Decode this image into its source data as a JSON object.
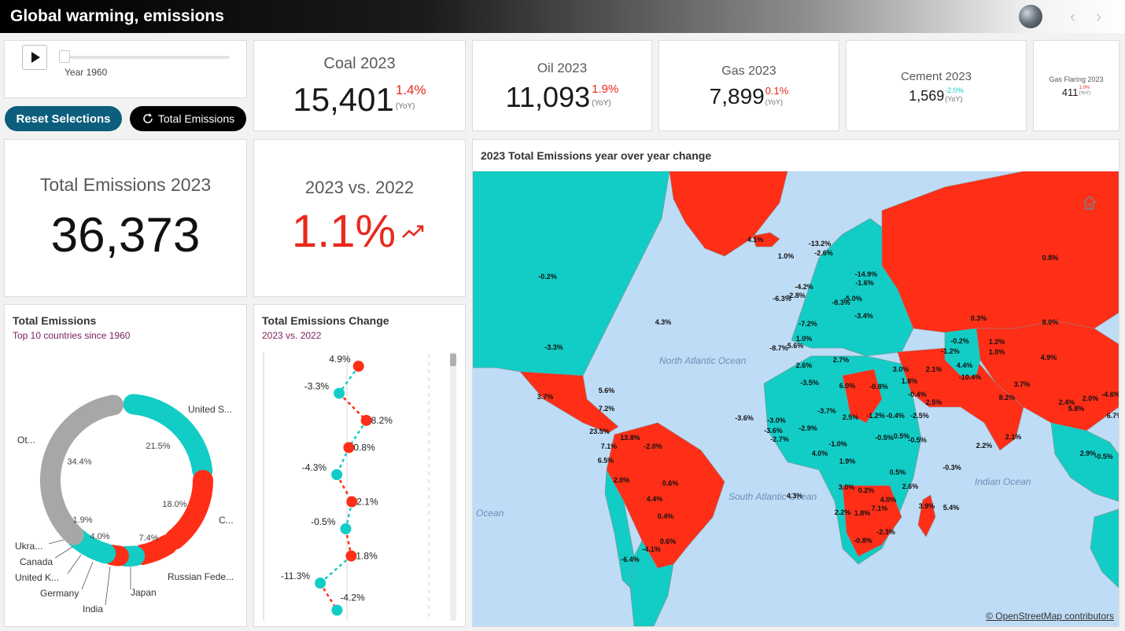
{
  "header": {
    "title": "Global warming, emissions",
    "prev_icon": "chevron-left-icon",
    "next_icon": "chevron-right-icon"
  },
  "player": {
    "play_icon": "play-icon",
    "year_label": "Year 1960",
    "slider_value": 1960
  },
  "buttons": {
    "reset": "Reset Selections",
    "total": "Total Emissions",
    "total_icon": "refresh-icon"
  },
  "kpis": [
    {
      "title": "Coal 2023",
      "value": "15,401",
      "pct": "1.4%",
      "yoy": "(YoY)"
    },
    {
      "title": "Oil 2023",
      "value": "11,093",
      "pct": "1.9%",
      "yoy": "(YoY)"
    },
    {
      "title": "Gas 2023",
      "value": "7,899",
      "pct": "0.1%",
      "yoy": "(YoY)"
    },
    {
      "title": "Cement 2023",
      "value": "1,569",
      "pct": "-2.0%",
      "yoy": "(YoY)"
    },
    {
      "title": "Gas Flaring 2023",
      "value": "411",
      "pct": "1.0%",
      "yoy": "(YoY)"
    }
  ],
  "total": {
    "title": "Total Emissions 2023",
    "value": "36,373"
  },
  "compare": {
    "title": "2023 vs. 2022",
    "value": "1.1%",
    "trend_icon": "trend-up-icon"
  },
  "colors": {
    "increase": "#ff2e17",
    "decrease": "#12cdc6",
    "other": "#a7a7a7",
    "water": "#bedcf5",
    "reset_button": "#0c5e7c"
  },
  "donut": {
    "title": "Total Emissions",
    "subtitle": "Top 10 countries since 1960",
    "chart_data": {
      "type": "pie",
      "categories": [
        "United S...",
        "C...",
        "Russian Fede...",
        "Japan",
        "India",
        "Germany",
        "United K...",
        "Canada",
        "Ukra...",
        "Ot..."
      ],
      "values": [
        21.5,
        18.0,
        7.4,
        4.0,
        1.9,
        0,
        0,
        0,
        0,
        34.4
      ],
      "value_labels": [
        "21.5%",
        "18.0%",
        "7.4%",
        "4.0%",
        "1.9%",
        "",
        "",
        "",
        "",
        "34.4%"
      ]
    }
  },
  "change": {
    "title": "Total Emissions Change",
    "subtitle": "2023 vs. 2022",
    "chart_data": {
      "type": "line",
      "values": [
        4.9,
        -3.3,
        8.2,
        0.8,
        -4.3,
        2.1,
        -0.5,
        1.8,
        -11.3,
        -4.2
      ],
      "labels": [
        "4.9%",
        "-3.3%",
        "8.2%",
        "0.8%",
        "-4.3%",
        "2.1%",
        "-0.5%",
        "1.8%",
        "-11.3%",
        "-4.2%"
      ]
    }
  },
  "map": {
    "title": "2023 Total Emissions year over year change",
    "credit": "© OpenStreetMap contributors",
    "home_icon": "home-icon",
    "oceans": [
      "North Atlantic Ocean",
      "South Atlantic Ocean",
      "Indian Ocean",
      "Ocean"
    ],
    "labels": [
      "-0.2%",
      "-3.3%",
      "4.3%",
      "3.7%",
      "4.1%",
      "1.0%",
      "-13.2%",
      "-2.6%",
      "0.8%",
      "0.3%",
      "8.0%",
      "4.9%",
      "-6.3%",
      "-2.8%",
      "-14.9%",
      "-1.6%",
      "-4.2%",
      "-5.0%",
      "-8.3%",
      "-3.4%",
      "-7.2%",
      "-8.7%",
      "5.6%",
      "1.0%",
      "2.7%",
      "2.6%",
      "6.0%",
      "-0.8%",
      "3.0%",
      "2.1%",
      "4.4%",
      "-10.4%",
      "1.8%",
      "2.5%",
      "8.2%",
      "3.7%",
      "-0.2%",
      "1.2%",
      "1.0%",
      "-1.2%",
      "-3.5%",
      "-3.7%",
      "2.5%",
      "-1.2%",
      "-0.4%",
      "-2.5%",
      "2.1%",
      "2.4%",
      "5.8%",
      "2.0%",
      "-4.6%",
      "6.7%",
      "-3.6%",
      "-3.0%",
      "-3.6%",
      "-2.9%",
      "-2.7%",
      "4.0%",
      "-1.0%",
      "-0.5%",
      "0.5%",
      "-0.5%",
      "2.2%",
      "2.9%",
      "-0.5%",
      "-0.3%",
      "1.9%",
      "0.5%",
      "2.6%",
      "3.0%",
      "0.2%",
      "4.0%",
      "7.1%",
      "2.2%",
      "1.8%",
      "-2.3%",
      "-0.8%",
      "3.9%",
      "5.4%",
      "4.3%",
      "5.6%",
      "7.2%",
      "23.5%",
      "13.8%",
      "-2.0%",
      "6.5%",
      "7.1%",
      "2.0%",
      "0.6%",
      "4.4%",
      "0.4%",
      "0.6%",
      "-4.1%",
      "-6.4%",
      "-0.4%"
    ]
  }
}
